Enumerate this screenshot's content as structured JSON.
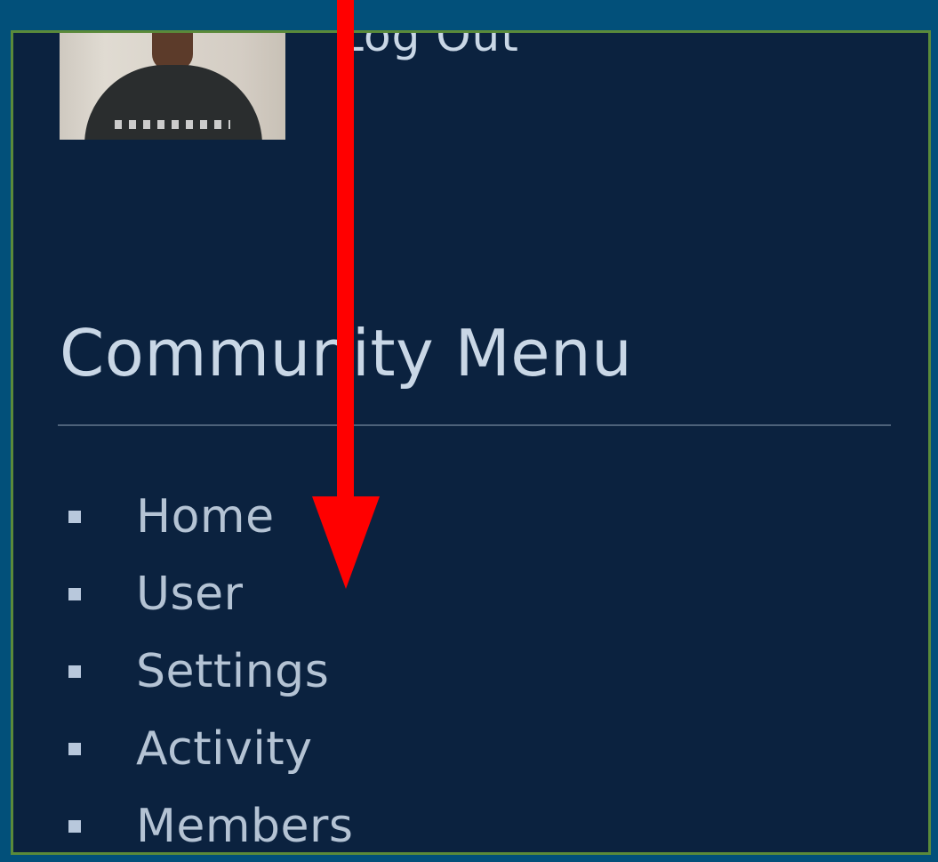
{
  "header": {
    "logout_label": "Log Out"
  },
  "sidebar": {
    "title": "Community Menu",
    "items": [
      {
        "label": "Home"
      },
      {
        "label": "User"
      },
      {
        "label": "Settings"
      },
      {
        "label": "Activity"
      },
      {
        "label": "Members"
      }
    ]
  },
  "colors": {
    "page_background": "#02507a",
    "panel_background": "#0b223f",
    "panel_border": "#5a8a3a",
    "text": "#c9d7e6",
    "annotation_arrow": "#ff0000"
  },
  "icons": {
    "bullet": "square-bullet-icon",
    "annotation": "down-arrow-icon"
  }
}
